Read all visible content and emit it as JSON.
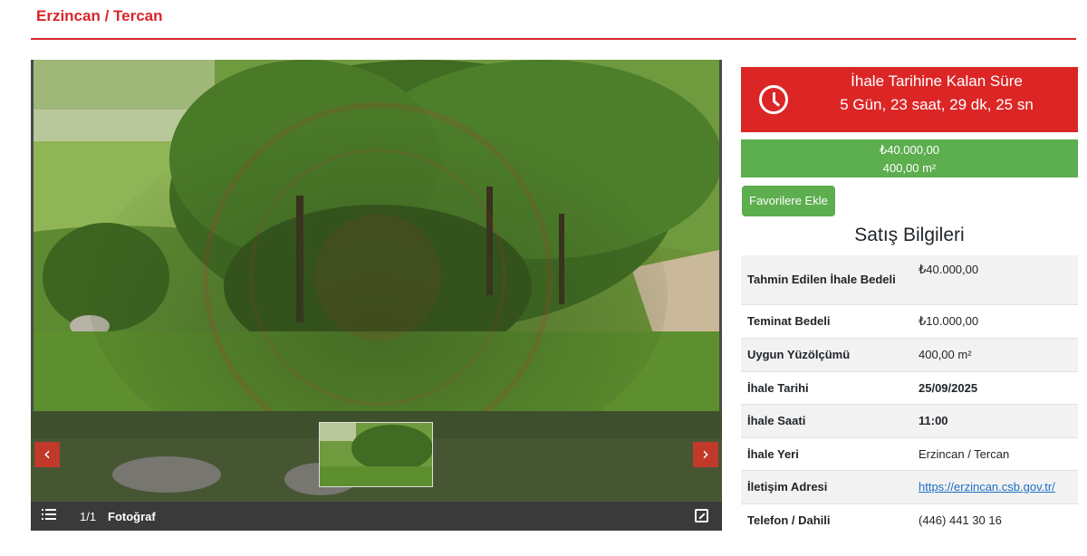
{
  "breadcrumb": "Erzincan / Tercan",
  "gallery": {
    "counter": "1/1",
    "label": "Fotoğraf",
    "prev_icon": "chevron-left-icon",
    "next_icon": "chevron-right-icon",
    "prev_glyph": "‹",
    "next_glyph": "›"
  },
  "countdown": {
    "title": "İhale Tarihine Kalan Süre",
    "value": "5 Gün, 23 saat, 29 dk, 25 sn",
    "icon": "clock-icon"
  },
  "price": {
    "amount": "₺40.000,00",
    "area": "400,00 m²"
  },
  "favorite_button": "Favorilere Ekle",
  "section_title": "Satış Bilgileri",
  "info": {
    "rows": [
      {
        "label": "Tahmin Edilen İhale Bedeli",
        "value": "₺40.000,00"
      },
      {
        "label": "Teminat Bedeli",
        "value": "₺10.000,00"
      },
      {
        "label": "Uygun Yüzölçümü",
        "value": "400,00 m²"
      },
      {
        "label": "İhale Tarihi",
        "value": "25/09/2025"
      },
      {
        "label": "İhale Saati",
        "value": "11:00"
      },
      {
        "label": "İhale Yeri",
        "value": "Erzincan / Tercan"
      },
      {
        "label": "İletişim Adresi",
        "value": "https://erzincan.csb.gov.tr/"
      },
      {
        "label": "Telefon / Dahili",
        "value": "(446) 441 30 16"
      }
    ]
  },
  "colors": {
    "brand_red": "#d9262b",
    "countdown_red": "#dc2626",
    "green": "#5cae4e",
    "link_blue": "#1a6fc4"
  }
}
